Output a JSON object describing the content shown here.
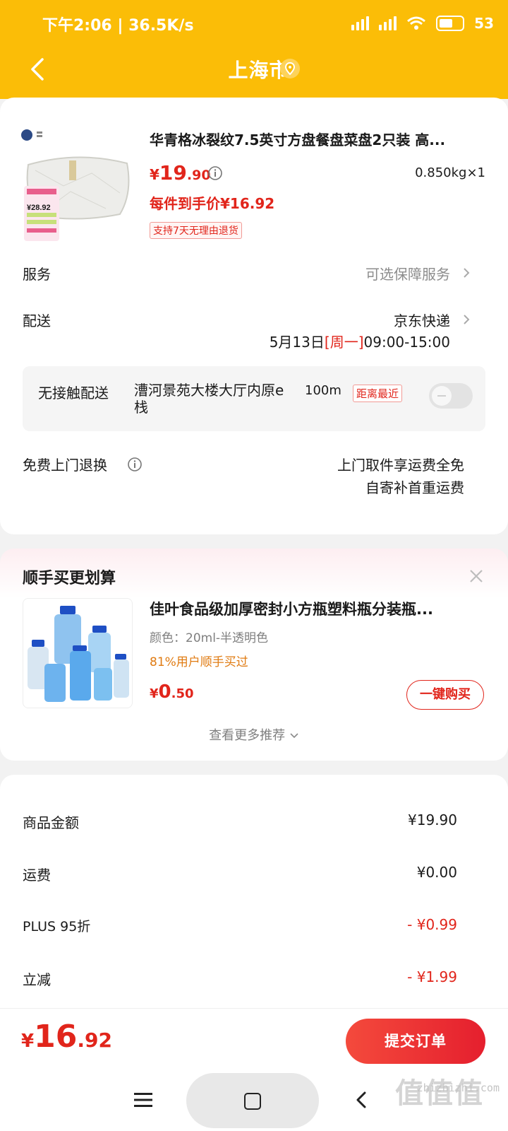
{
  "status_bar": {
    "time_speed": "下午2:06 | 36.5K/s",
    "battery": "53"
  },
  "header": {
    "title": "上海市",
    "icons": {
      "back": "back-arrow-icon",
      "location": "location-pin-icon"
    }
  },
  "product": {
    "shop_logo": "shop-logo",
    "title": "华青格冰裂纹7.5英寸方盘餐盘菜盘2只装 高...",
    "price": {
      "currency": "¥",
      "int": "19",
      "dec": ".90"
    },
    "weight_qty": "0.850kg×1",
    "net_price": "每件到手价¥16.92",
    "return_badge": "支持7天无理由退货",
    "thumb_tag": "¥28.92"
  },
  "service": {
    "label": "服务",
    "value": "可选保障服务"
  },
  "delivery": {
    "label": "配送",
    "carrier": "京东快递",
    "date": "5月13日",
    "weekday": "[周一]",
    "time": "09:00-15:00"
  },
  "no_contact": {
    "label": "无接触配送",
    "address": "漕河景苑大楼大厅内原e栈",
    "distance": "100m",
    "badge": "距离最近",
    "enabled": false
  },
  "free_return": {
    "label": "免费上门退换",
    "line1": "上门取件享运费全免",
    "line2": "自寄补首重运费"
  },
  "recommend": {
    "title": "顺手买更划算",
    "item": {
      "title": "佳叶食品级加厚密封小方瓶塑料瓶分装瓶...",
      "spec": "颜色：20ml-半透明色",
      "social": "81%用户顺手买过",
      "price": {
        "currency": "¥",
        "int": "0",
        "dec": ".50"
      },
      "buy_label": "一键购买"
    },
    "more_label": "查看更多推荐"
  },
  "summary": [
    {
      "label": "商品金额",
      "value": "¥19.90",
      "color": "#1a1a1a"
    },
    {
      "label": "运费",
      "value": "¥0.00",
      "color": "#1a1a1a"
    },
    {
      "label": "PLUS 95折",
      "value": "- ¥0.99",
      "color": "#e1251b"
    },
    {
      "label": "立减",
      "value": "- ¥1.99",
      "color": "#e1251b"
    }
  ],
  "bottom": {
    "total": {
      "currency": "¥",
      "int": "16",
      "dec": ".92"
    },
    "submit_label": "提交订单"
  },
  "watermark": {
    "site": "zhizhizhi.com",
    "mark": "值值值"
  },
  "colors": {
    "header": "#fbbd07",
    "accent": "#e1251b",
    "orange": "#e07b12"
  }
}
